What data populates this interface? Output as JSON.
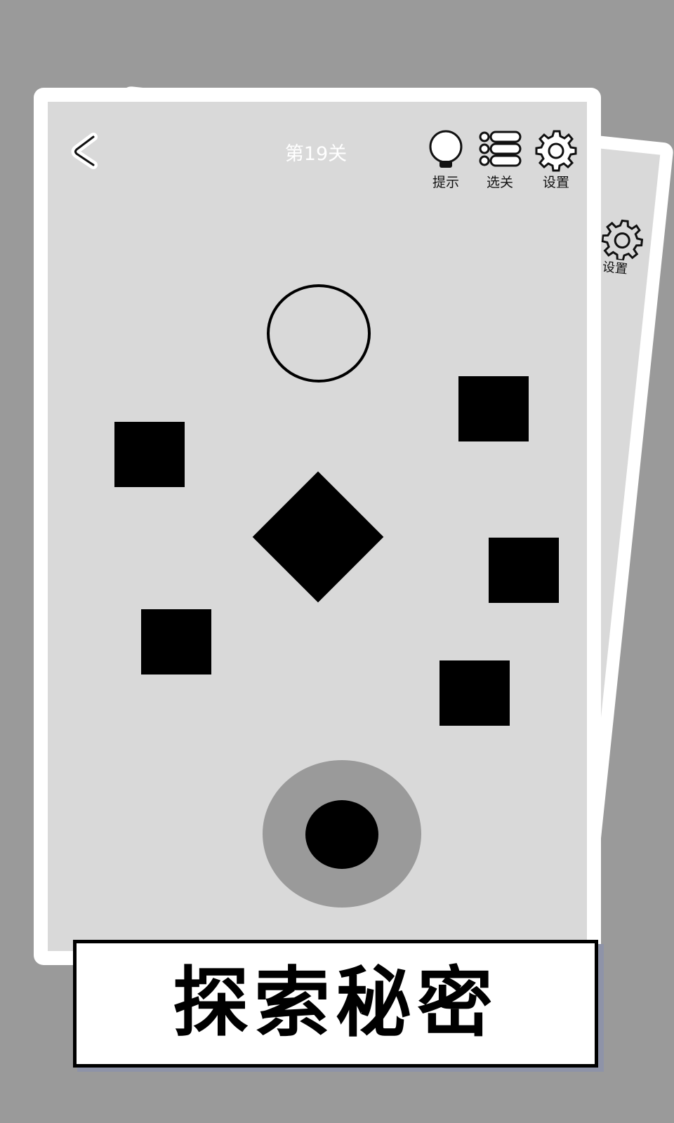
{
  "header": {
    "level_title": "第19关"
  },
  "toolbar": {
    "hint_label": "提示",
    "level_select_label": "选关",
    "settings_label": "设置"
  },
  "back_card": {
    "settings_label": "设置"
  },
  "banner": {
    "text": "探索秘密"
  },
  "icons": {
    "back": "chevron-left-icon",
    "hint": "lightbulb-icon",
    "level_select": "list-icon",
    "settings": "gear-icon"
  },
  "colors": {
    "page_background": "#9a9a9a",
    "card_frame": "#ffffff",
    "board": "#d9d9d9",
    "shapes": "#000000",
    "joystick_base": "#9a9a9a",
    "banner_shadow": "#8e93a8"
  }
}
